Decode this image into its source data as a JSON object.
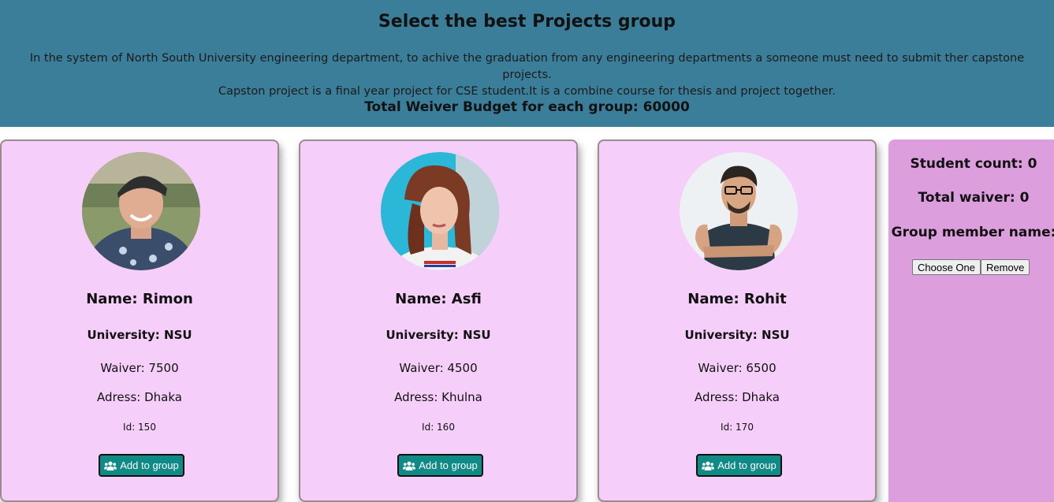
{
  "header": {
    "title": "Select the best Projects group",
    "description_line1": "In the system of North South University engineering department, to achive the graduation from any engineering departments a someone must need to submit ther capstone projects.",
    "description_line2": "Capston project is a final year project for CSE student.It is a combine course for thesis and project together.",
    "budget": "Total Weiver Budget for each group: 60000"
  },
  "students": [
    {
      "name": "Name: Rimon",
      "university": "University: NSU",
      "waiver": "Waiver: 7500",
      "adress": "Adress: Dhaka",
      "id": "Id: 150",
      "button_label": "Add to group"
    },
    {
      "name": "Name: Asfi",
      "university": "University: NSU",
      "waiver": "Waiver: 4500",
      "adress": "Adress: Khulna",
      "id": "Id: 160",
      "button_label": "Add to group"
    },
    {
      "name": "Name: Rohit",
      "university": "University: NSU",
      "waiver": "Waiver: 6500",
      "adress": "Adress: Dhaka",
      "id": "Id: 170",
      "button_label": "Add to group"
    }
  ],
  "sidebar": {
    "student_count": "Student count: 0",
    "total_waiver": "Total waiver: 0",
    "group_member_name": "Group member name:",
    "choose_label": "Choose One",
    "remove_label": "Remove"
  },
  "colors": {
    "header_bg": "#3b7e99",
    "card_bg": "#f6cefa",
    "sidebar_bg": "#dd9edd",
    "button_bg": "#0f8a86"
  },
  "icons": {
    "avatar": "profile-photo",
    "button": "users-icon"
  }
}
